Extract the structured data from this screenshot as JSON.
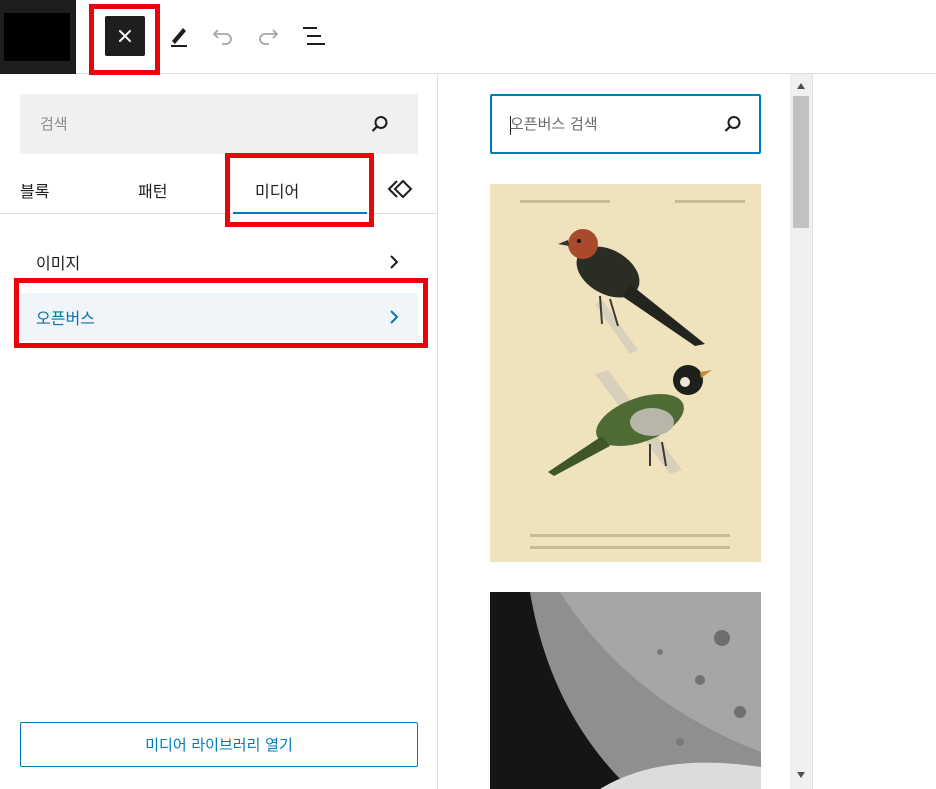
{
  "toolbar": {
    "close_icon": "close-icon",
    "tools": [
      {
        "name": "edit-tool-icon"
      },
      {
        "name": "undo-icon"
      },
      {
        "name": "redo-icon"
      },
      {
        "name": "list-view-icon"
      }
    ]
  },
  "inserter": {
    "search_placeholder": "검색",
    "tabs": [
      {
        "label": "블록",
        "active": false
      },
      {
        "label": "패턴",
        "active": false
      },
      {
        "label": "미디어",
        "active": true
      }
    ],
    "categories": [
      {
        "label": "이미지",
        "active": false
      },
      {
        "label": "오픈버스",
        "active": true
      }
    ],
    "library_button": "미디어 라이브러리 열기"
  },
  "media": {
    "search_placeholder": "오픈버스 검색",
    "items": [
      {
        "kind": "illustration",
        "subject": "two birds on branches"
      },
      {
        "kind": "photo",
        "subject": "lunar surface"
      }
    ]
  },
  "colors": {
    "accent": "#007cba",
    "highlight": "#e8060c",
    "active_bg": "#f0f5fa"
  }
}
